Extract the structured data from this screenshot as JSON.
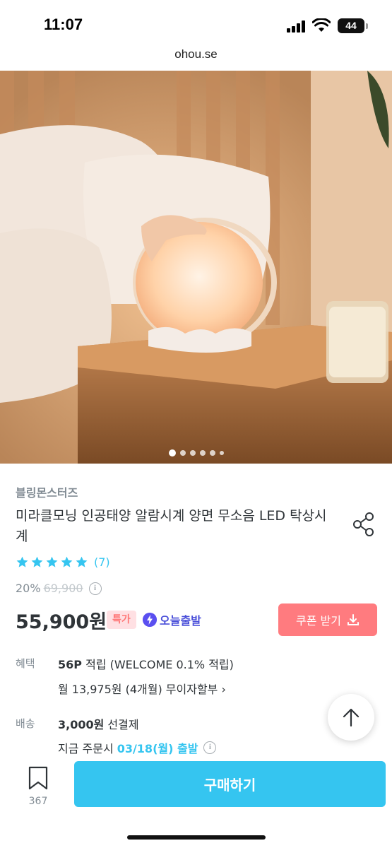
{
  "status_bar": {
    "time": "11:07",
    "battery": "44"
  },
  "browser": {
    "url": "ohou.se"
  },
  "gallery": {
    "total_dots": 6,
    "active_index": 0
  },
  "product": {
    "brand": "블링몬스터즈",
    "title": "미라클모닝 인공태양 알람시계 양면 무소음 LED 탁상시계",
    "rating_stars": 5,
    "review_count": "(7)",
    "discount_rate": "20%",
    "original_price": "69,900",
    "price": "55,900원",
    "badge_special": "특가",
    "badge_today": "오늘출발",
    "coupon_label": "쿠폰 받기"
  },
  "benefit": {
    "label": "혜택",
    "points": "56P",
    "points_rest": " 적립 (WELCOME 0.1% 적립)",
    "installment": "월 13,975원 (4개월) 무이자할부 ›"
  },
  "shipping": {
    "label": "배송",
    "fee": "3,000원",
    "fee_rest": " 선결제",
    "order_prefix": "지금 주문시",
    "ship_date": "03/18(월) 출발"
  },
  "bottom_bar": {
    "bookmark_count": "367",
    "buy_label": "구매하기"
  },
  "colors": {
    "accent": "#35c5f0",
    "coupon": "#ff7b7f",
    "special": "#ffe0e3",
    "today": "#4a4fd9"
  }
}
